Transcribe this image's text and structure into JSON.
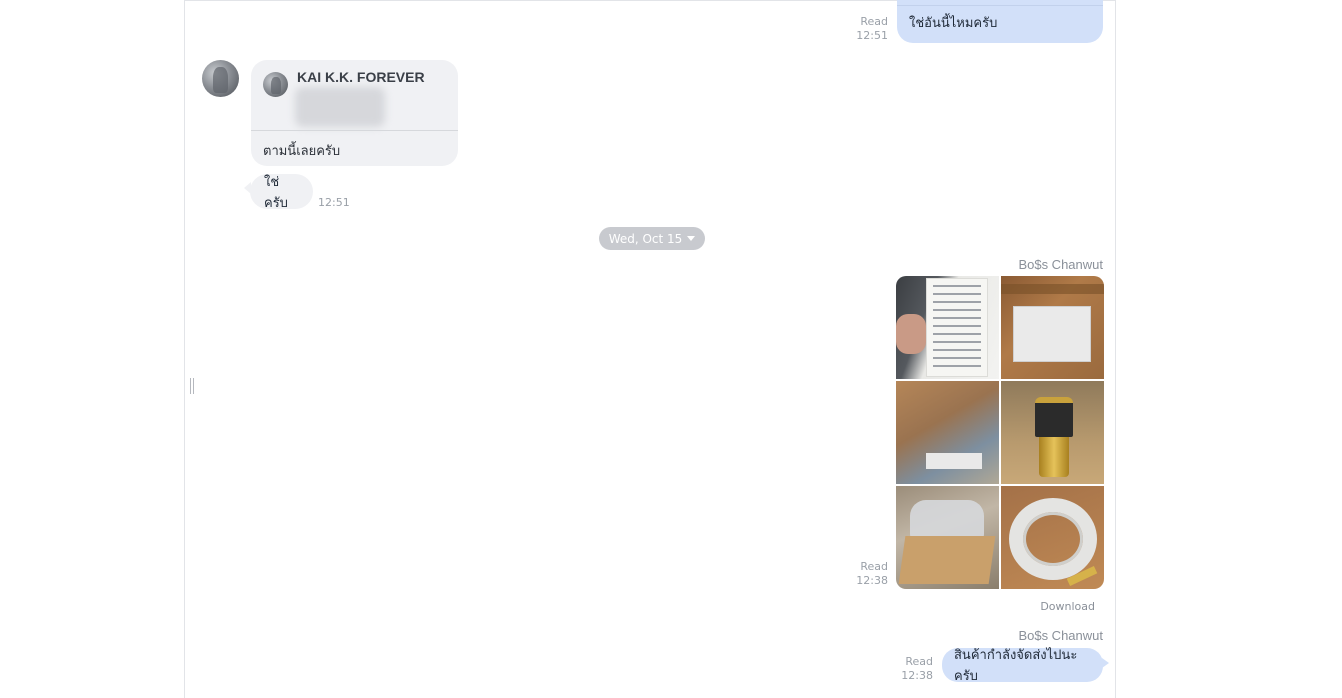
{
  "messages": {
    "top_out": {
      "read_label": "Read",
      "time": "12:51",
      "text": "ใช่อันนี้ไหมครับ"
    },
    "contact_card": {
      "name": "KAI K.K. FOREVER",
      "text": "ตามนี้เลยครับ"
    },
    "reply_in": {
      "text": "ใช่ครับ",
      "time": "12:51"
    },
    "date_separator": {
      "label": "Wed, Oct 15"
    },
    "photos_out": {
      "sender": "Bo$s Chanwut",
      "read_label": "Read",
      "time": "12:38",
      "download_label": "Download",
      "photo_count": 6
    },
    "last_out": {
      "sender": "Bo$s Chanwut",
      "read_label": "Read",
      "time": "12:38",
      "text": "สินค้ากำลังจัดส่งไปนะครับ"
    }
  },
  "colors": {
    "outgoing_bubble": "#d2e0f9",
    "incoming_bubble": "#f0f1f4",
    "date_pill": "#c8cacf",
    "meta_text": "#9aa0a8"
  },
  "icons": {
    "date_caret": "chevron-down-icon",
    "resize_handle": "drag-handle-icon"
  }
}
